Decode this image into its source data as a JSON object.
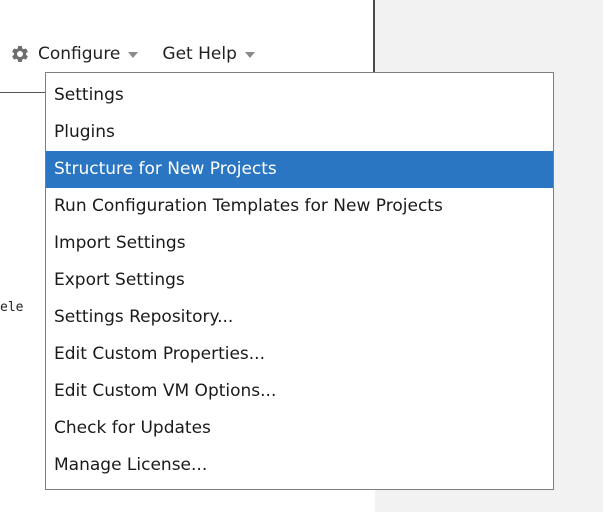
{
  "toolbar": {
    "gear_icon": "gear-icon",
    "configure_label": "Configure",
    "help_label": "Get Help"
  },
  "side_text": "ele",
  "menu": {
    "items": [
      {
        "label": "Settings"
      },
      {
        "label": "Plugins"
      },
      {
        "label": "Structure for New Projects",
        "selected": true
      },
      {
        "label": "Run Configuration Templates for New Projects"
      },
      {
        "label": "Import Settings"
      },
      {
        "label": "Export Settings"
      },
      {
        "label": "Settings Repository..."
      },
      {
        "label": "Edit Custom Properties..."
      },
      {
        "label": "Edit Custom VM Options..."
      },
      {
        "label": "Check for Updates"
      },
      {
        "label": "Manage License..."
      }
    ]
  },
  "colors": {
    "selection": "#2a76c2",
    "panel": "#f2f2f2"
  }
}
